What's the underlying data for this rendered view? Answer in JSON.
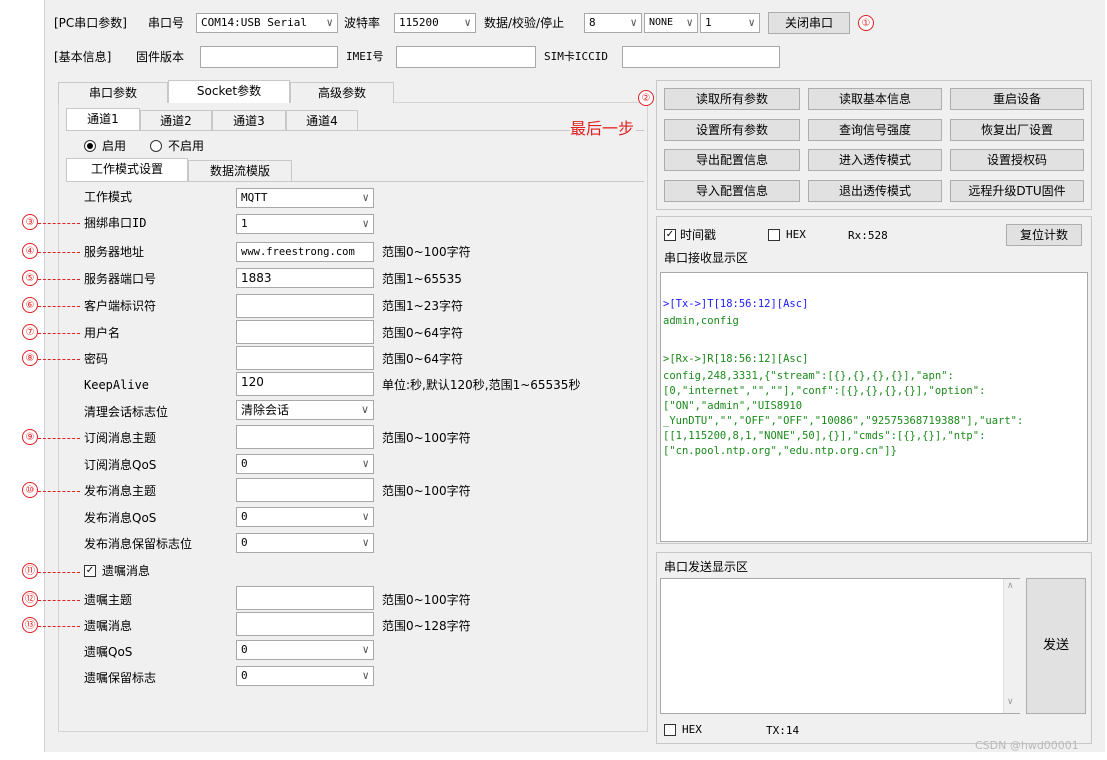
{
  "top_row1": {
    "group_label": "[PC串口参数]",
    "port_label": "串口号",
    "port_value": "COM14:USB Serial",
    "baud_label": "波特率",
    "baud_value": "115200",
    "dps_label": "数据/校验/停止",
    "data_bits": "8",
    "parity": "NONE",
    "stop_bits": "1",
    "close_button": "关闭串口",
    "marker": "①"
  },
  "top_row2": {
    "group_label": "[基本信息]",
    "firmware_label": "固件版本",
    "firmware_value": "",
    "imei_label": "IMEI号",
    "imei_value": "",
    "iccid_label": "SIM卡ICCID",
    "iccid_value": ""
  },
  "main_tabs": [
    "串口参数",
    "Socket参数",
    "高级参数"
  ],
  "channel_tabs": [
    "通道1",
    "通道2",
    "通道3",
    "通道4"
  ],
  "enable": {
    "on": "启用",
    "off": "不启用"
  },
  "sub_tabs": [
    "工作模式设置",
    "数据流模版"
  ],
  "form": {
    "work_mode": {
      "label": "工作模式",
      "value": "MQTT"
    },
    "bind_id": {
      "label": "捆绑串口ID",
      "value": "1",
      "marker": "③"
    },
    "server_addr": {
      "label": "服务器地址",
      "value": "www.freestrong.com",
      "hint": "范围0~100字符",
      "marker": "④"
    },
    "server_port": {
      "label": "服务器端口号",
      "value": "1883",
      "hint": "范围1~65535",
      "marker": "⑤"
    },
    "client_id": {
      "label": "客户端标识符",
      "value": "",
      "hint": "范围1~23字符",
      "marker": "⑥"
    },
    "username": {
      "label": "用户名",
      "value": "",
      "hint": "范围0~64字符",
      "marker": "⑦"
    },
    "password": {
      "label": "密码",
      "value": "",
      "hint": "范围0~64字符",
      "marker": "⑧"
    },
    "keepalive": {
      "label": "KeepAlive",
      "value": "120",
      "hint": "单位:秒,默认120秒,范围1~65535秒"
    },
    "clean_session": {
      "label": "清理会话标志位",
      "value": "清除会话"
    },
    "sub_topic": {
      "label": "订阅消息主题",
      "value": "",
      "hint": "范围0~100字符",
      "marker": "⑨"
    },
    "sub_qos": {
      "label": "订阅消息QoS",
      "value": "0"
    },
    "pub_topic": {
      "label": "发布消息主题",
      "value": "",
      "hint": "范围0~100字符",
      "marker": "⑩"
    },
    "pub_qos": {
      "label": "发布消息QoS",
      "value": "0"
    },
    "pub_retain": {
      "label": "发布消息保留标志位",
      "value": "0"
    },
    "will_enable": {
      "label": "遗嘱消息",
      "marker": "⑪"
    },
    "will_topic": {
      "label": "遗嘱主题",
      "value": "",
      "hint": "范围0~100字符",
      "marker": "⑫"
    },
    "will_msg": {
      "label": "遗嘱消息",
      "value": "",
      "hint": "范围0~128字符",
      "marker": "⑬"
    },
    "will_qos": {
      "label": "遗嘱QoS",
      "value": "0"
    },
    "will_retain": {
      "label": "遗嘱保留标志",
      "value": "0"
    }
  },
  "actions": {
    "marker": "②",
    "note": "最后一步",
    "buttons": [
      [
        "读取所有参数",
        "读取基本信息",
        "重启设备"
      ],
      [
        "设置所有参数",
        "查询信号强度",
        "恢复出厂设置"
      ],
      [
        "导出配置信息",
        "进入透传模式",
        "设置授权码"
      ],
      [
        "导入配置信息",
        "退出透传模式",
        "远程升级DTU固件"
      ]
    ]
  },
  "receive": {
    "timestamp_label": "时间戳",
    "hex_label": "HEX",
    "rx_count": "Rx:528",
    "reset_button": "复位计数",
    "area_title": "串口接收显示区",
    "tx_header": ">[Tx->]T[18:56:12][Asc]",
    "tx_body": "admin,config",
    "rx_header": ">[Rx->]R[18:56:12][Asc]",
    "rx_body": "config,248,3331,{\"stream\":[{},{},{},{}],\"apn\":\n[0,\"internet\",\"\",\"\"],\"conf\":[{},{},{},{}],\"option\":\n[\"ON\",\"admin\",\"UIS8910\n_YunDTU\",\"\",\"OFF\",\"OFF\",\"10086\",\"92575368719388\"],\"uart\":\n[[1,115200,8,1,\"NONE\",50],{}],\"cmds\":[{},{}],\"ntp\":\n[\"cn.pool.ntp.org\",\"edu.ntp.org.cn\"]}"
  },
  "send": {
    "area_title": "串口发送显示区",
    "send_button": "发送",
    "hex_label": "HEX",
    "tx_count": "TX:14"
  },
  "watermark": "CSDN @hwd00001",
  "colors": {
    "annotation": "#e02020",
    "tx_text": "#1a1aff",
    "rx_text": "#1a8a1a"
  }
}
